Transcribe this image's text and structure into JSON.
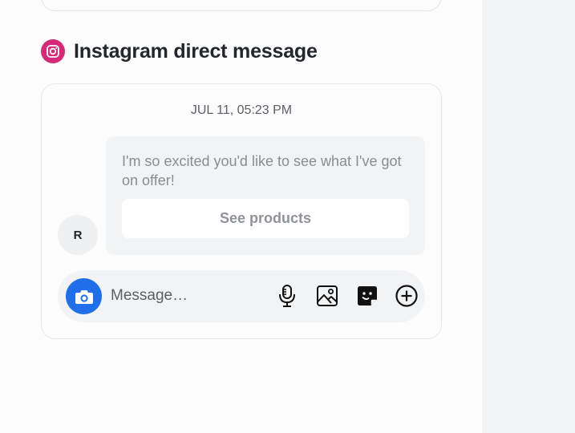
{
  "section": {
    "title": "Instagram direct message",
    "icon": "instagram-icon",
    "icon_color": "#d62976"
  },
  "message": {
    "timestamp": "JUL 11, 05:23 PM",
    "avatar_initial": "R",
    "text": "I'm so excited you'd like to see what I've got on offer!",
    "button_label": "See products"
  },
  "composer": {
    "placeholder": "Message…",
    "camera_color": "#1f6feb",
    "icons": [
      "microphone-icon",
      "image-icon",
      "sticker-icon",
      "add-circle-icon"
    ]
  }
}
